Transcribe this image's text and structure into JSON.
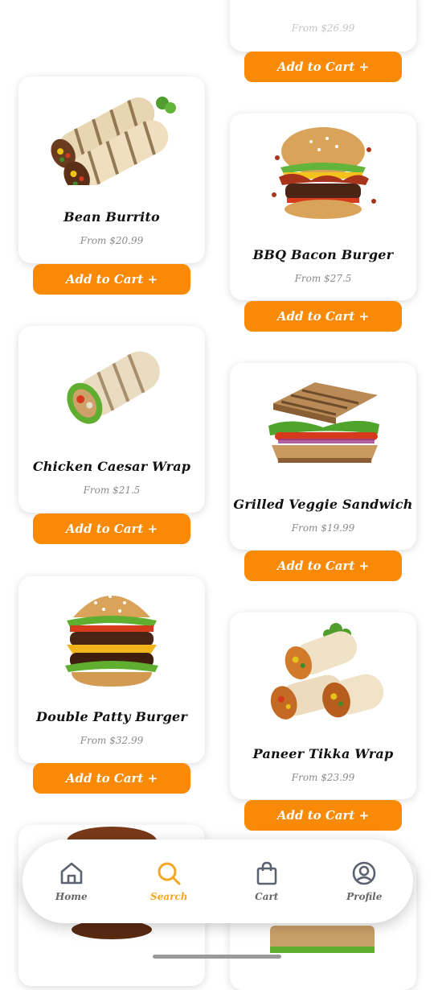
{
  "products": {
    "partial_top_price": "From $26.99",
    "add_label": "Add to Cart +",
    "items": [
      {
        "name": "Bean Burrito",
        "price": "From $20.99"
      },
      {
        "name": "BBQ Bacon Burger",
        "price": "From $27.5"
      },
      {
        "name": "Chicken Caesar Wrap",
        "price": "From $21.5"
      },
      {
        "name": "Grilled Veggie Sandwich",
        "price": "From $19.99"
      },
      {
        "name": "Double Patty Burger",
        "price": "From $32.99"
      },
      {
        "name": "Paneer Tikka Wrap",
        "price": "From $23.99"
      }
    ]
  },
  "nav": {
    "items": [
      {
        "label": "Home",
        "icon": "home-icon"
      },
      {
        "label": "Search",
        "icon": "search-icon"
      },
      {
        "label": "Cart",
        "icon": "bag-icon"
      },
      {
        "label": "Profile",
        "icon": "profile-icon"
      }
    ],
    "active": "Search",
    "active_color": "#f5a623"
  },
  "colors": {
    "accent": "#f98a08",
    "text": "#111111",
    "muted": "#8a8a8a"
  }
}
